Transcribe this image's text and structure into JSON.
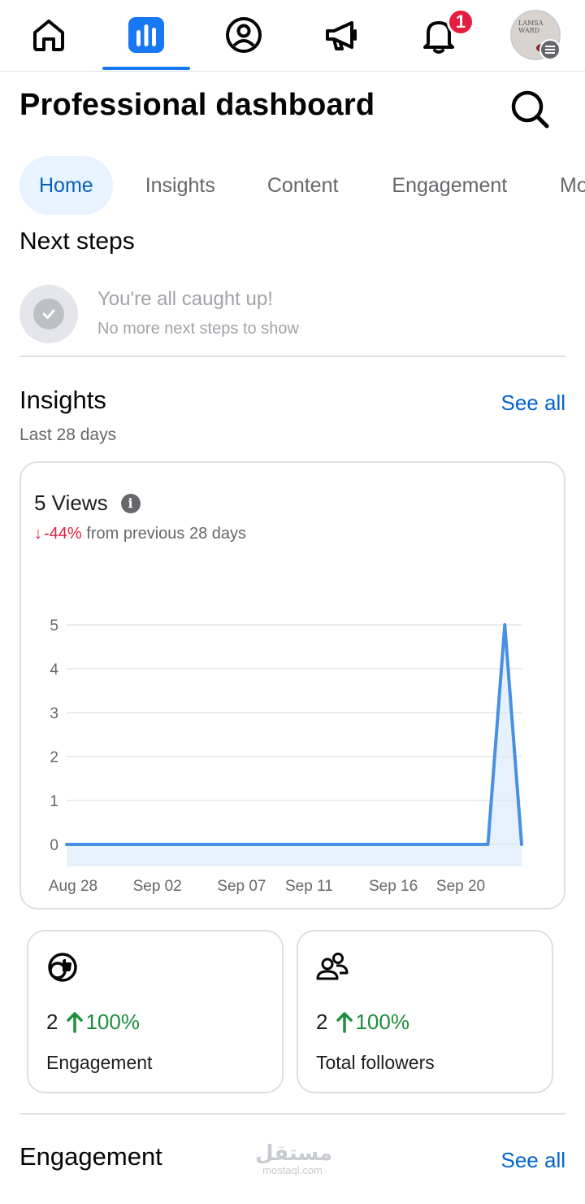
{
  "nav": {
    "items": [
      "home",
      "dashboard",
      "profile",
      "ads",
      "notifications",
      "account"
    ],
    "notification_count": "1",
    "avatar_text": "LAMSA WARD"
  },
  "header": {
    "title": "Professional dashboard"
  },
  "tabs": [
    {
      "label": "Home",
      "active": true
    },
    {
      "label": "Insights",
      "active": false
    },
    {
      "label": "Content",
      "active": false
    },
    {
      "label": "Engagement",
      "active": false
    },
    {
      "label": "Mo",
      "active": false
    }
  ],
  "next_steps": {
    "title": "Next steps",
    "empty_title": "You're all caught up!",
    "empty_subtitle": "No more next steps to show"
  },
  "insights": {
    "title": "Insights",
    "see_all": "See all",
    "period": "Last 28 days",
    "views_label": "5 Views",
    "change_arrow": "↓",
    "change_value": "-44%",
    "change_text": " from previous 28 days"
  },
  "chart_data": {
    "type": "area",
    "title": "",
    "xlabel": "",
    "ylabel": "",
    "ylim": [
      0,
      5
    ],
    "y_ticks": [
      "0",
      "1",
      "2",
      "3",
      "4",
      "5"
    ],
    "x_ticks": [
      "Aug 28",
      "Sep 02",
      "Sep 07",
      "Sep 11",
      "Sep 16",
      "Sep 20"
    ],
    "x": [
      "Aug 28",
      "Aug 29",
      "Aug 30",
      "Aug 31",
      "Sep 01",
      "Sep 02",
      "Sep 03",
      "Sep 04",
      "Sep 05",
      "Sep 06",
      "Sep 07",
      "Sep 08",
      "Sep 09",
      "Sep 10",
      "Sep 11",
      "Sep 12",
      "Sep 13",
      "Sep 14",
      "Sep 15",
      "Sep 16",
      "Sep 17",
      "Sep 18",
      "Sep 19",
      "Sep 20",
      "Sep 21",
      "Sep 22",
      "Sep 23",
      "Sep 24"
    ],
    "values": [
      0,
      0,
      0,
      0,
      0,
      0,
      0,
      0,
      0,
      0,
      0,
      0,
      0,
      0,
      0,
      0,
      0,
      0,
      0,
      0,
      0,
      0,
      0,
      0,
      0,
      0,
      5,
      0
    ],
    "color": "#4a90e2",
    "grid": true
  },
  "metrics": [
    {
      "value": "2",
      "percent": "100%",
      "label": "Engagement",
      "icon": "engagement-icon"
    },
    {
      "value": "2",
      "percent": "100%",
      "label": "Total followers",
      "icon": "followers-icon"
    }
  ],
  "engagement": {
    "title": "Engagement",
    "see_all": "See all"
  },
  "watermark": {
    "arabic": "مستقل",
    "latin": "mostaql.com"
  },
  "colors": {
    "accent": "#1877f2",
    "link": "#0064d1",
    "negative": "#e41e3f",
    "positive": "#1e8e3e"
  }
}
